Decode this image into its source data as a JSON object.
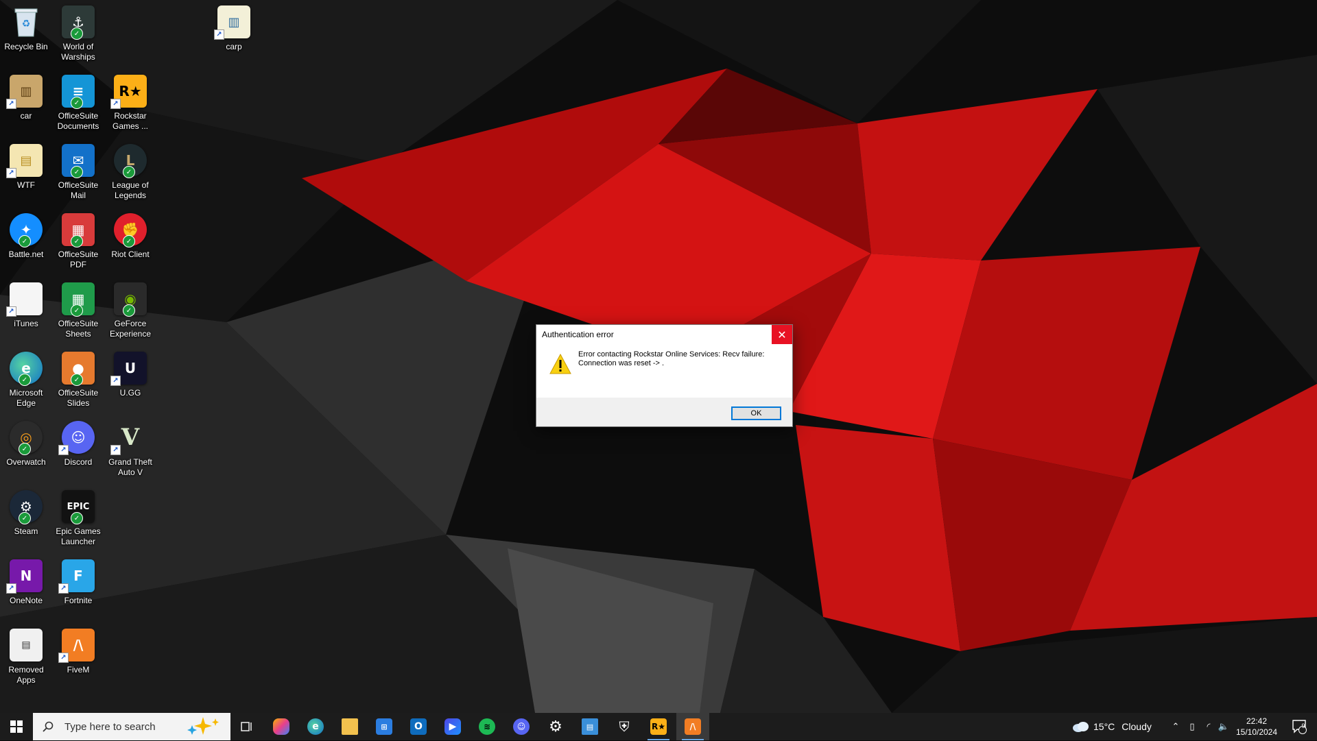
{
  "desktop": {
    "icons": [
      {
        "label": "Recycle Bin",
        "icon": "recycle-bin-icon"
      },
      {
        "label": "World of Warships",
        "icon": "world-of-warships-icon"
      },
      {
        "label": "carp",
        "icon": "file-icon"
      },
      {
        "label": "car",
        "icon": "file-icon"
      },
      {
        "label": "OfficeSuite Documents",
        "icon": "officesuite-documents-icon"
      },
      {
        "label": "Rockstar Games ...",
        "icon": "rockstar-games-icon"
      },
      {
        "label": "WTF",
        "icon": "folder-icon"
      },
      {
        "label": "OfficeSuite Mail",
        "icon": "officesuite-mail-icon"
      },
      {
        "label": "League of Legends",
        "icon": "league-of-legends-icon"
      },
      {
        "label": "Battle.net",
        "icon": "battlenet-icon"
      },
      {
        "label": "OfficeSuite PDF",
        "icon": "officesuite-pdf-icon"
      },
      {
        "label": "Riot Client",
        "icon": "riot-client-icon"
      },
      {
        "label": "iTunes",
        "icon": "file-icon"
      },
      {
        "label": "OfficeSuite Sheets",
        "icon": "officesuite-sheets-icon"
      },
      {
        "label": "GeForce Experience",
        "icon": "geforce-experience-icon"
      },
      {
        "label": "Microsoft Edge",
        "icon": "edge-icon"
      },
      {
        "label": "OfficeSuite Slides",
        "icon": "officesuite-slides-icon"
      },
      {
        "label": "U.GG",
        "icon": "ugg-icon"
      },
      {
        "label": "Overwatch",
        "icon": "overwatch-icon"
      },
      {
        "label": "Discord",
        "icon": "discord-icon"
      },
      {
        "label": "Grand Theft Auto V",
        "icon": "gta-v-icon"
      },
      {
        "label": "Steam",
        "icon": "steam-icon"
      },
      {
        "label": "Epic Games Launcher",
        "icon": "epic-games-icon"
      },
      {
        "label": "OneNote",
        "icon": "onenote-icon"
      },
      {
        "label": "Fortnite",
        "icon": "fortnite-icon"
      },
      {
        "label": "Removed Apps",
        "icon": "removed-apps-icon"
      },
      {
        "label": "FiveM",
        "icon": "fivem-icon"
      }
    ]
  },
  "dialog": {
    "title": "Authentication error",
    "message": "Error contacting Rockstar Online Services: Recv failure: Connection was reset -> .",
    "ok_label": "OK"
  },
  "taskbar": {
    "search_placeholder": "Type here to search",
    "weather": {
      "temp": "15°C",
      "condition": "Cloudy"
    },
    "clock": {
      "time": "22:42",
      "date": "15/10/2024"
    },
    "notification_count": "9"
  },
  "colors": {
    "accent": "#0078d7",
    "close_red": "#e81123",
    "taskbar": "#1c1c1c",
    "wallpaper_red": "#c01010"
  }
}
